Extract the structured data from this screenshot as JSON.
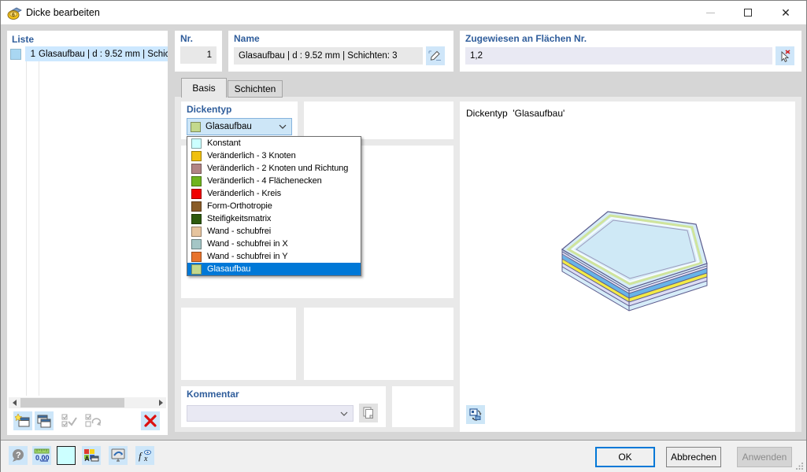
{
  "window": {
    "title": "Dicke bearbeiten"
  },
  "liste": {
    "label": "Liste",
    "rows": [
      {
        "number": "1",
        "text": "Glasaufbau | d : 9.52 mm | Schic",
        "color": "#a9d7f2"
      }
    ]
  },
  "fields": {
    "nr": {
      "label": "Nr.",
      "value": "1"
    },
    "name": {
      "label": "Name",
      "value": "Glasaufbau | d : 9.52 mm | Schichten: 3"
    },
    "zugewiesen": {
      "label": "Zugewiesen an Flächen Nr.",
      "value": "1,2"
    }
  },
  "tabs": [
    {
      "label": "Basis",
      "active": true
    },
    {
      "label": "Schichten",
      "active": false
    }
  ],
  "dickentyp": {
    "label": "Dickentyp",
    "selected": {
      "label": "Glasaufbau",
      "color": "#c3d98c"
    },
    "options": [
      {
        "label": "Konstant",
        "color": "#ccffff"
      },
      {
        "label": "Veränderlich - 3 Knoten",
        "color": "#f0c010"
      },
      {
        "label": "Veränderlich - 2 Knoten und Richtung",
        "color": "#b28484"
      },
      {
        "label": "Veränderlich - 4 Flächenecken",
        "color": "#6fb41e"
      },
      {
        "label": "Veränderlich - Kreis",
        "color": "#f00000"
      },
      {
        "label": "Form-Orthotropie",
        "color": "#8a5c28"
      },
      {
        "label": "Steifigkeitsmatrix",
        "color": "#2e5a0e"
      },
      {
        "label": "Wand - schubfrei",
        "color": "#e6c49e"
      },
      {
        "label": "Wand - schubfrei in X",
        "color": "#a4c6c6"
      },
      {
        "label": "Wand - schubfrei in Y",
        "color": "#e8732c"
      },
      {
        "label": "Glasaufbau",
        "color": "#c3d98c",
        "selected": true
      }
    ]
  },
  "kommentar": {
    "label": "Kommentar",
    "value": ""
  },
  "preview": {
    "title": "Dickentyp  'Glasaufbau'",
    "layer_colors": [
      "#d6ecf8",
      "#e4e4f6",
      "#68b4e8",
      "#f2e946",
      "#dcdcf4"
    ]
  },
  "buttons": {
    "ok": "OK",
    "cancel": "Abbrechen",
    "apply": "Anwenden"
  },
  "colors": {
    "accent": "#0078d7",
    "label_blue": "#2f5d9b",
    "selection_row": "#cde8ff",
    "button_blue_bg": "#cde6f9",
    "field_gray": "#e8e8e8",
    "field_lilac": "#e9e9f3"
  },
  "icons": {
    "dialog": "thickness-layers",
    "rename": "pencil",
    "assign": "cursor-with-red-x",
    "delete": "red-x",
    "comment_copy": "pages",
    "rotate_view": "image-rotate-arrows"
  }
}
